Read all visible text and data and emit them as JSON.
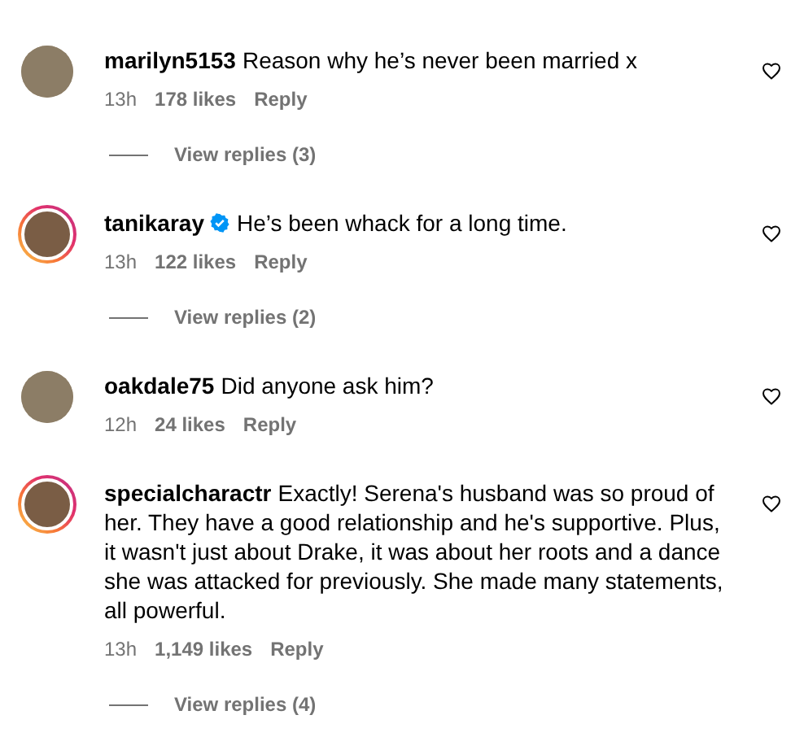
{
  "comments": [
    {
      "username": "marilyn5153",
      "verified": false,
      "story_ring": false,
      "text": "Reason why he’s never been married x",
      "time": "13h",
      "likes": "178 likes",
      "reply": "Reply",
      "view_replies": "View replies (3)"
    },
    {
      "username": "tanikaray",
      "verified": true,
      "story_ring": true,
      "text": "He’s been whack for a long time.",
      "time": "13h",
      "likes": "122 likes",
      "reply": "Reply",
      "view_replies": "View replies (2)"
    },
    {
      "username": "oakdale75",
      "verified": false,
      "story_ring": false,
      "text": "Did anyone ask him?",
      "time": "12h",
      "likes": "24 likes",
      "reply": "Reply"
    },
    {
      "username": "specialcharactr",
      "verified": false,
      "story_ring": true,
      "text": "Exactly! Serena's husband was so proud of her. They have a good relationship and he's supportive. Plus, it wasn't just about Drake, it was about her roots and a dance she was attacked for previously. She made many statements, all powerful.",
      "time": "13h",
      "likes": "1,149 likes",
      "reply": "Reply",
      "view_replies": "View replies (4)"
    }
  ]
}
